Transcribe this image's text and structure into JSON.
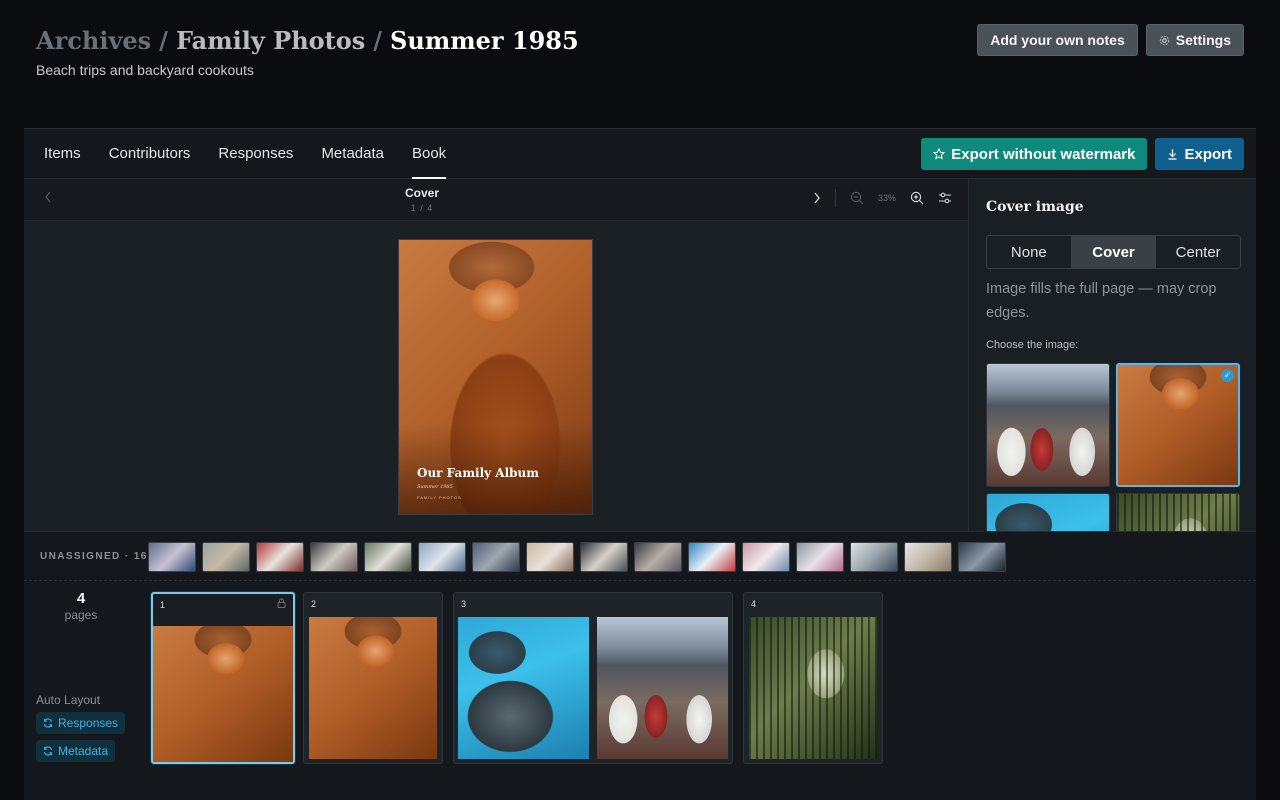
{
  "header": {
    "breadcrumb": [
      "Archives",
      "Family Photos",
      "Summer 1985"
    ],
    "separator": "/",
    "subtitle": "Beach trips and backyard cookouts",
    "add_notes_label": "Add your own notes",
    "settings_label": "Settings"
  },
  "tabs": [
    {
      "label": "Items",
      "active": false
    },
    {
      "label": "Contributors",
      "active": false
    },
    {
      "label": "Responses",
      "active": false
    },
    {
      "label": "Metadata",
      "active": false
    },
    {
      "label": "Book",
      "active": true
    }
  ],
  "actions": {
    "export_no_watermark": "Export without watermark",
    "export": "Export",
    "accent_teal": "#0e8a7c",
    "accent_blue": "#0f5f8f"
  },
  "viewer": {
    "page_title": "Cover",
    "page_counter": "1 / 4",
    "zoom": "33%",
    "cover_title": "Our Family Album",
    "cover_subtitle": "Summer 1985",
    "cover_small": "FAMILY PHOTOS"
  },
  "sidebar": {
    "title": "Cover image",
    "options": [
      {
        "label": "None",
        "active": false
      },
      {
        "label": "Cover",
        "active": true
      },
      {
        "label": "Center",
        "active": false
      }
    ],
    "description": "Image fills the full page — may crop edges.",
    "choose_label": "Choose the image:",
    "selected_index": 1
  },
  "unassigned": {
    "label": "UNASSIGNED · 16",
    "count": 16
  },
  "pages": {
    "count": "4",
    "count_label": "pages",
    "auto_layout_label": "Auto Layout",
    "responses_btn": "Responses",
    "metadata_btn": "Metadata",
    "items": [
      {
        "number": "1",
        "locked": true
      },
      {
        "number": "2",
        "locked": false
      },
      {
        "number": "3",
        "locked": false
      },
      {
        "number": "4",
        "locked": false
      }
    ]
  }
}
